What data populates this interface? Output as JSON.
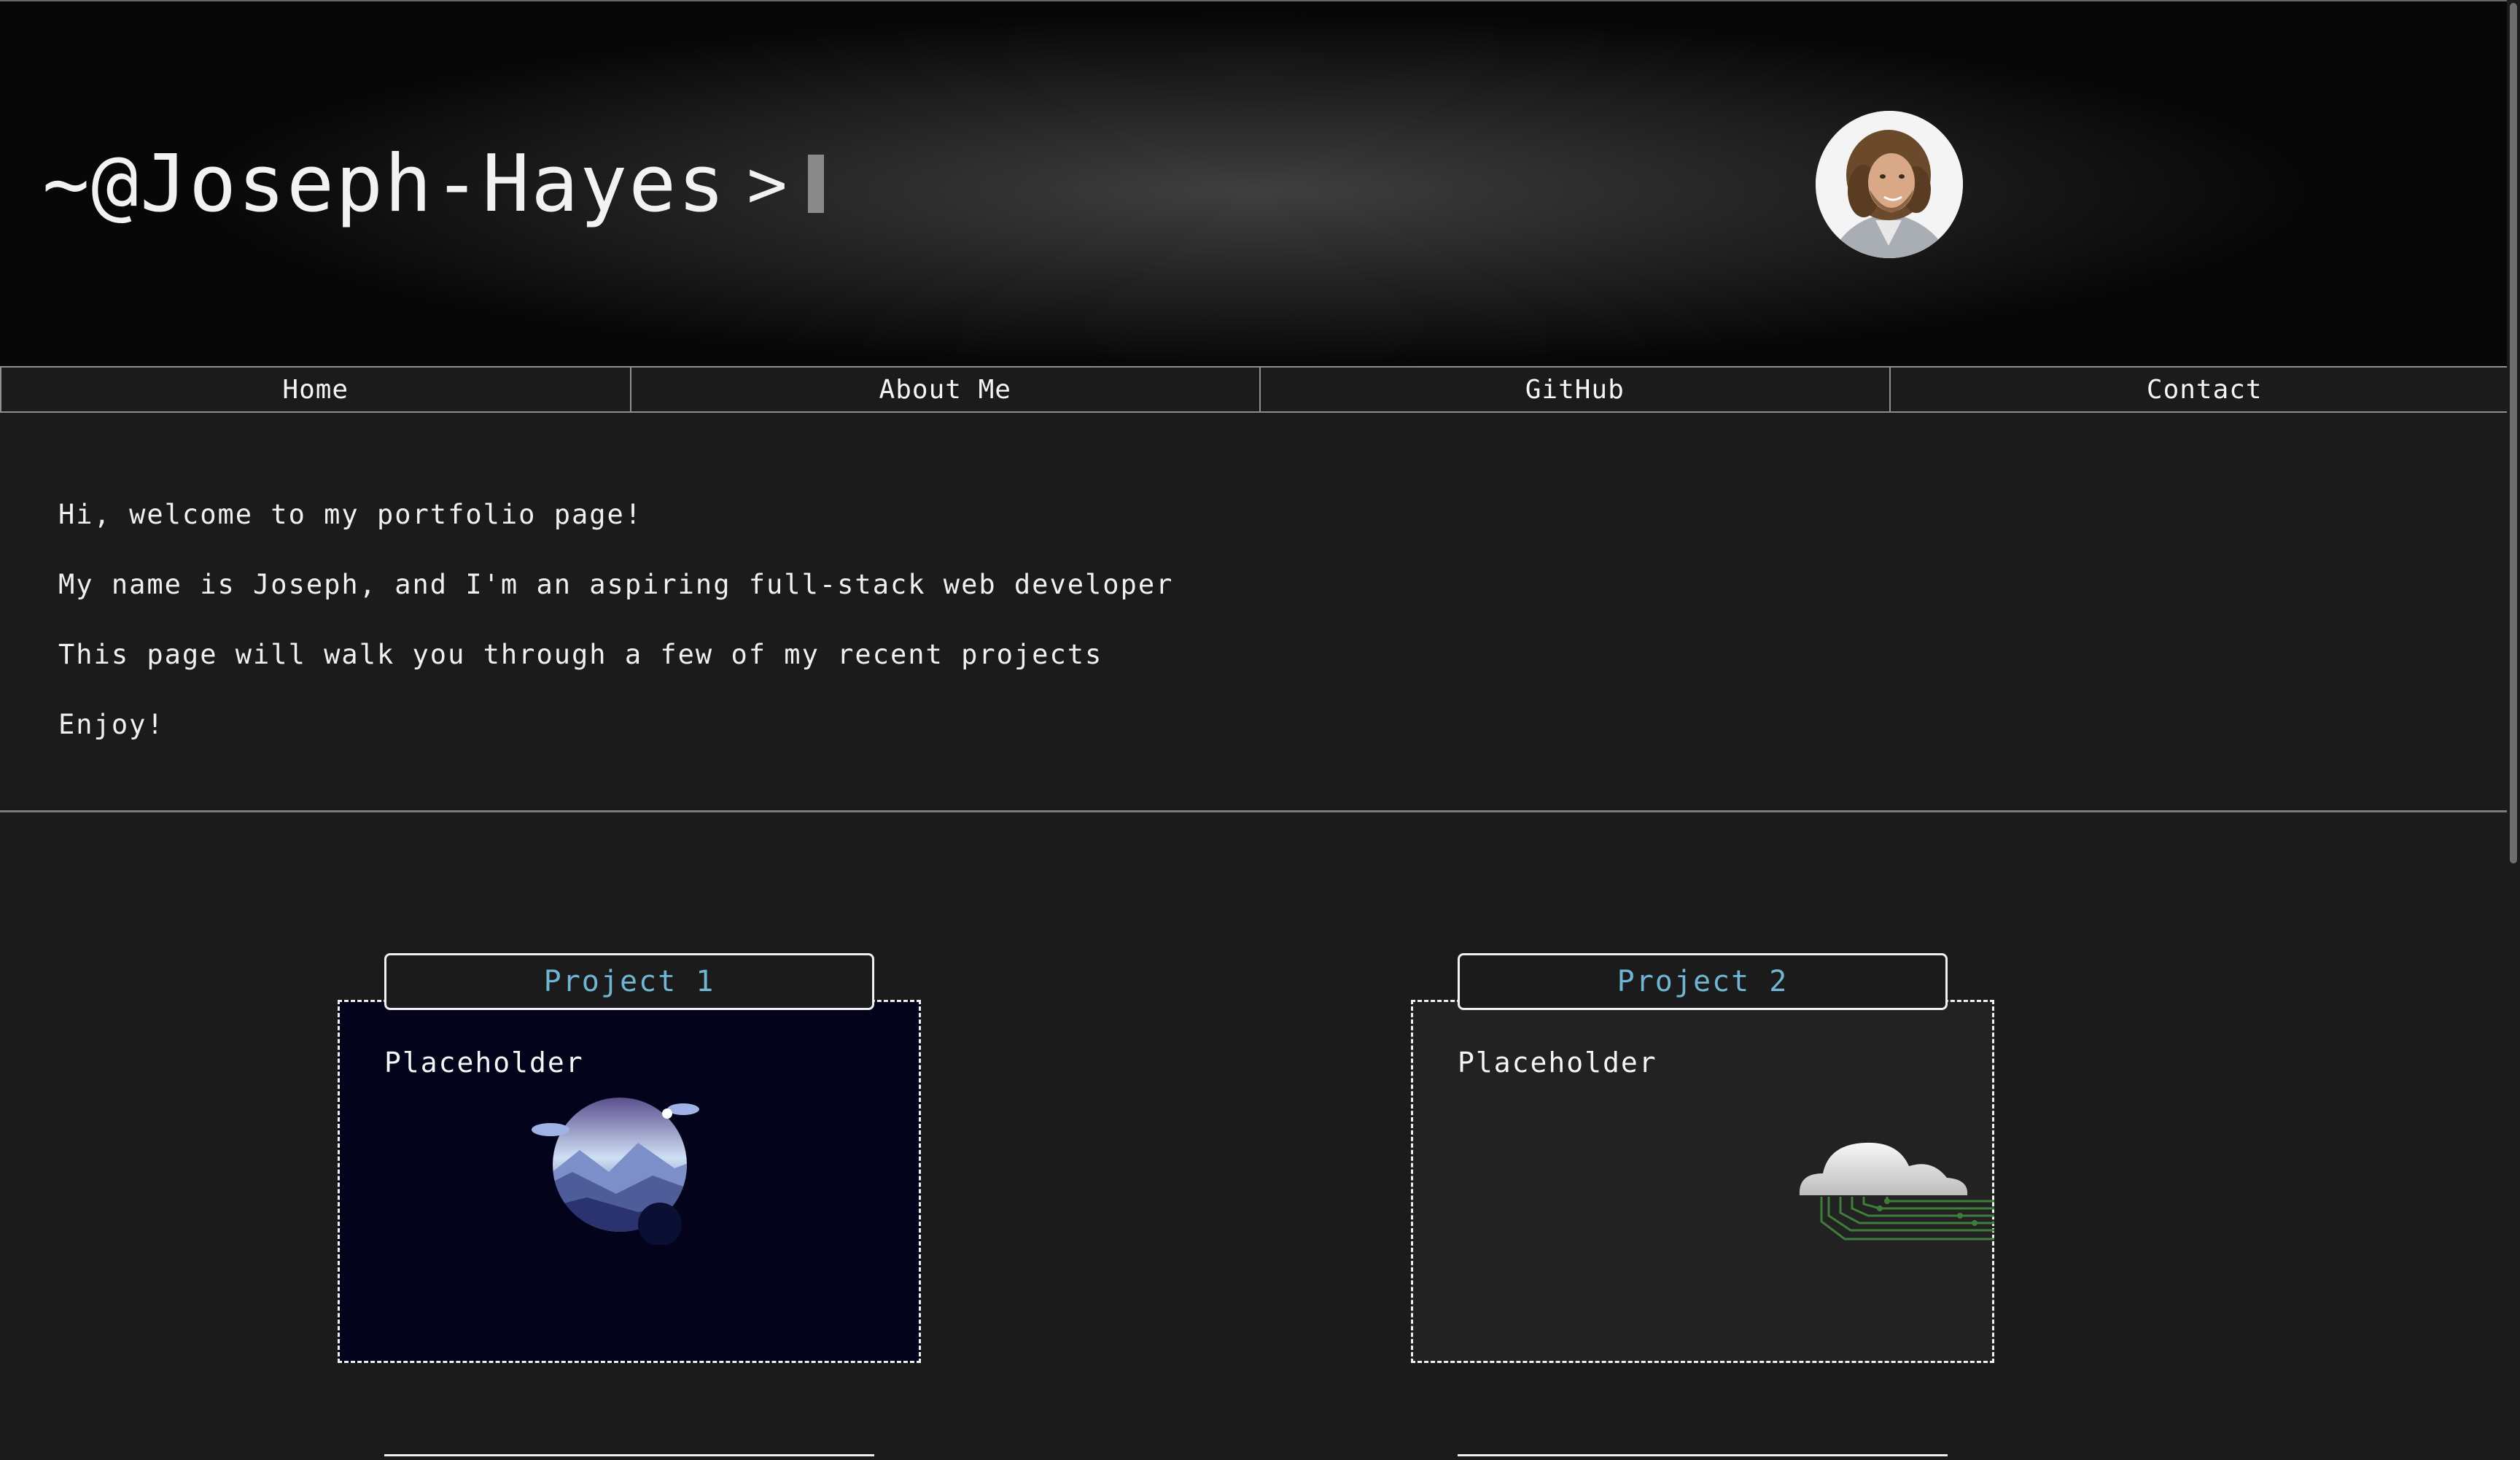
{
  "header": {
    "tilde": "~",
    "handle": "@Joseph-Hayes",
    "prompt": ">"
  },
  "nav": {
    "items": [
      {
        "label": "Home"
      },
      {
        "label": "About Me"
      },
      {
        "label": "GitHub"
      },
      {
        "label": "Contact"
      }
    ]
  },
  "intro": {
    "lines": [
      "Hi, welcome to my portfolio page!",
      "My name is Joseph, and I'm an aspiring full-stack web developer",
      "This page will walk you through a few of my recent projects",
      "Enjoy!"
    ]
  },
  "projects": [
    {
      "title": "Project 1",
      "description": "Placeholder",
      "icon": "mountain-night-icon"
    },
    {
      "title": "Project 2",
      "description": "Placeholder",
      "icon": "cloud-circuit-icon"
    }
  ],
  "colors": {
    "background": "#1b1b1b",
    "accent": "#6fb6d3",
    "text": "#f0f0f0"
  }
}
